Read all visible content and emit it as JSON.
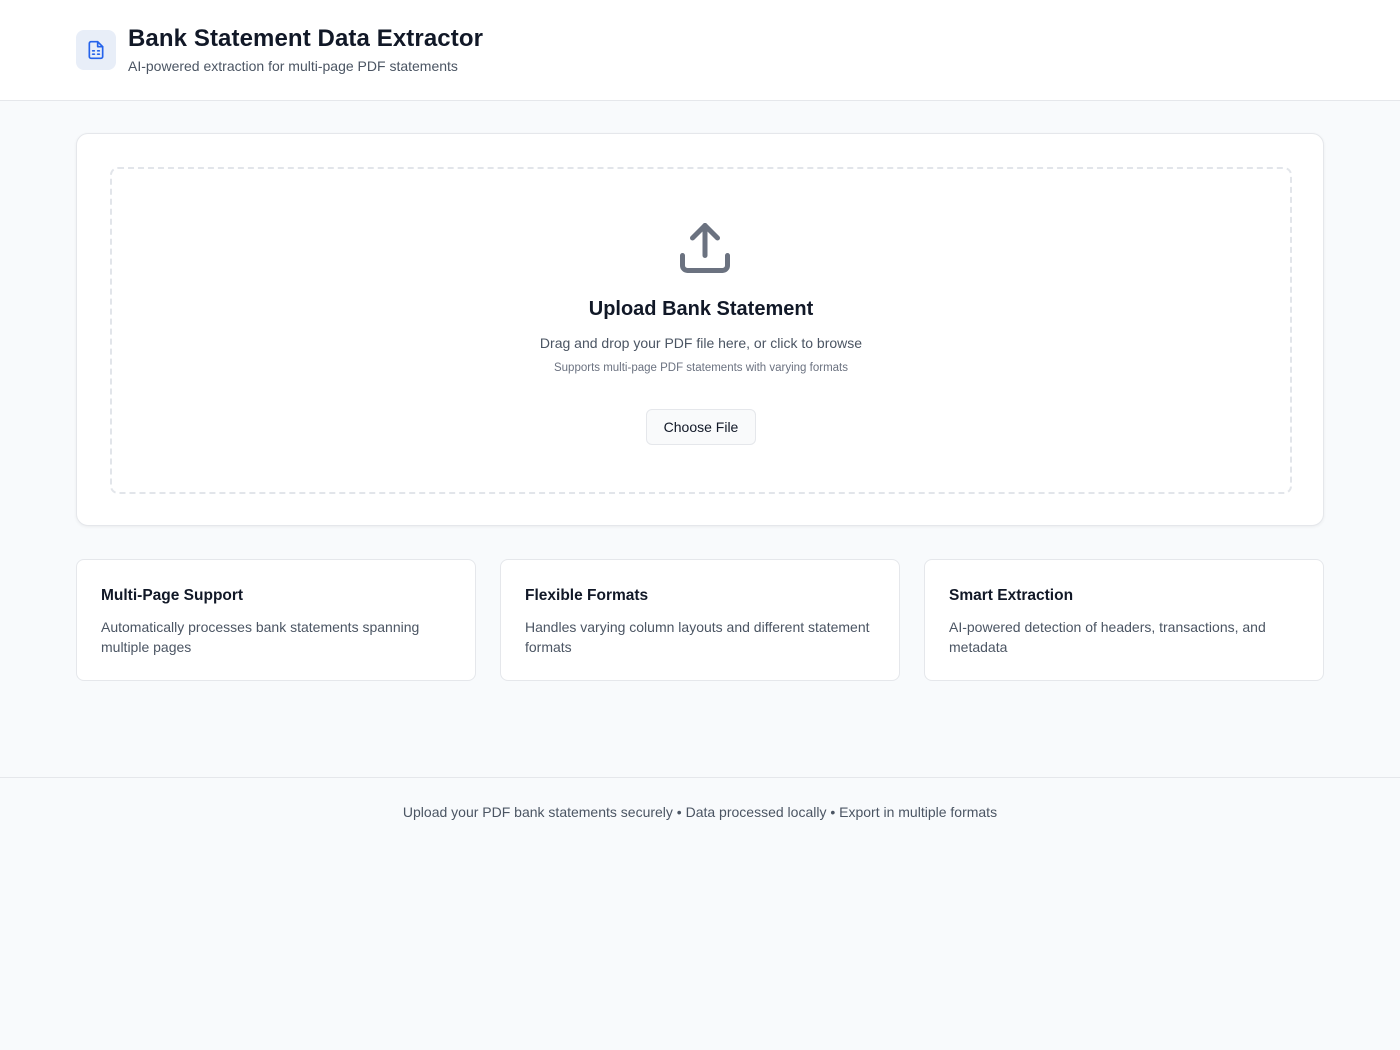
{
  "header": {
    "title": "Bank Statement Data Extractor",
    "subtitle": "AI-powered extraction for multi-page PDF statements",
    "logo_icon": "file-spreadsheet-icon"
  },
  "upload": {
    "icon": "upload-icon",
    "title": "Upload Bank Statement",
    "description": "Drag and drop your PDF file here, or click to browse",
    "note": "Supports multi-page PDF statements with varying formats",
    "button_label": "Choose File"
  },
  "features": [
    {
      "title": "Multi-Page Support",
      "description": "Automatically processes bank statements spanning multiple pages"
    },
    {
      "title": "Flexible Formats",
      "description": "Handles varying column layouts and different statement formats"
    },
    {
      "title": "Smart Extraction",
      "description": "AI-powered detection of headers, transactions, and metadata"
    }
  ],
  "footer": {
    "text": "Upload your PDF bank statements securely • Data processed locally • Export in multiple formats"
  },
  "colors": {
    "accent": "#2563eb",
    "logo_bg": "#e8eef8",
    "icon_gray": "#6b7280",
    "page_bg": "#f8fafc"
  }
}
